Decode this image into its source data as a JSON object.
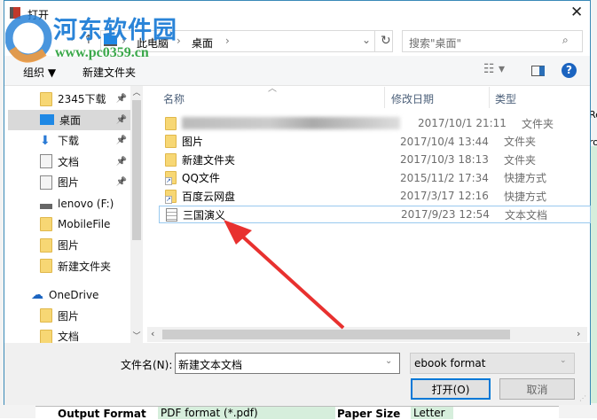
{
  "title": "打开",
  "watermark": {
    "name": "河东软件园",
    "url": "www.pc0359.cn"
  },
  "address": {
    "segments": [
      "此电脑",
      "桌面"
    ]
  },
  "search": {
    "placeholder": "搜索\"桌面\""
  },
  "toolbar": {
    "organize": "组织 ▼",
    "new_folder": "新建文件夹"
  },
  "nav": [
    {
      "label": "2345下载",
      "icon": "folder",
      "pinned": true
    },
    {
      "label": "桌面",
      "icon": "desktop",
      "pinned": true,
      "selected": true
    },
    {
      "label": "下载",
      "icon": "download",
      "pinned": true
    },
    {
      "label": "文档",
      "icon": "document",
      "pinned": true
    },
    {
      "label": "图片",
      "icon": "pictures",
      "pinned": true
    },
    {
      "label": "lenovo (F:)",
      "icon": "drive"
    },
    {
      "label": "MobileFile",
      "icon": "folder"
    },
    {
      "label": "图片",
      "icon": "folder"
    },
    {
      "label": "新建文件夹",
      "icon": "folder"
    },
    {
      "label": "OneDrive",
      "icon": "cloud"
    },
    {
      "label": "图片",
      "icon": "folder"
    },
    {
      "label": "文档",
      "icon": "folder"
    }
  ],
  "columns": {
    "name": "名称",
    "date": "修改日期",
    "type": "类型"
  },
  "files": [
    {
      "name": "",
      "date": "2017/10/1 21:11",
      "type": "文件夹",
      "icon": "folder",
      "blurred": true
    },
    {
      "name": "图片",
      "date": "2017/10/4 13:44",
      "type": "文件夹",
      "icon": "folder"
    },
    {
      "name": "新建文件夹",
      "date": "2017/10/3 18:13",
      "type": "文件夹",
      "icon": "folder"
    },
    {
      "name": "QQ文件",
      "date": "2015/11/2 17:34",
      "type": "快捷方式",
      "icon": "shortcut"
    },
    {
      "name": "百度云网盘",
      "date": "2017/3/17 12:16",
      "type": "快捷方式",
      "icon": "shortcut"
    },
    {
      "name": "三国演义",
      "date": "2017/9/23 12:54",
      "type": "文本文档",
      "icon": "text",
      "selected": true
    }
  ],
  "filename": {
    "label": "文件名(N):",
    "value": "新建文本文档"
  },
  "filetype": {
    "value": "ebook format"
  },
  "buttons": {
    "open": "打开(O)",
    "cancel": "取消"
  },
  "background": {
    "output_format_label": "Output Format",
    "output_format_value": "PDF format (*.pdf)",
    "paper_size_label": "Paper Size",
    "paper_size_value": "Letter",
    "partial_text_1": "Re",
    "partial_text_2": "ro"
  },
  "colors": {
    "accent": "#0078d7",
    "arrow": "#e8312f",
    "watermark_blue": "#2a84d8",
    "watermark_green": "#3aa84a"
  }
}
